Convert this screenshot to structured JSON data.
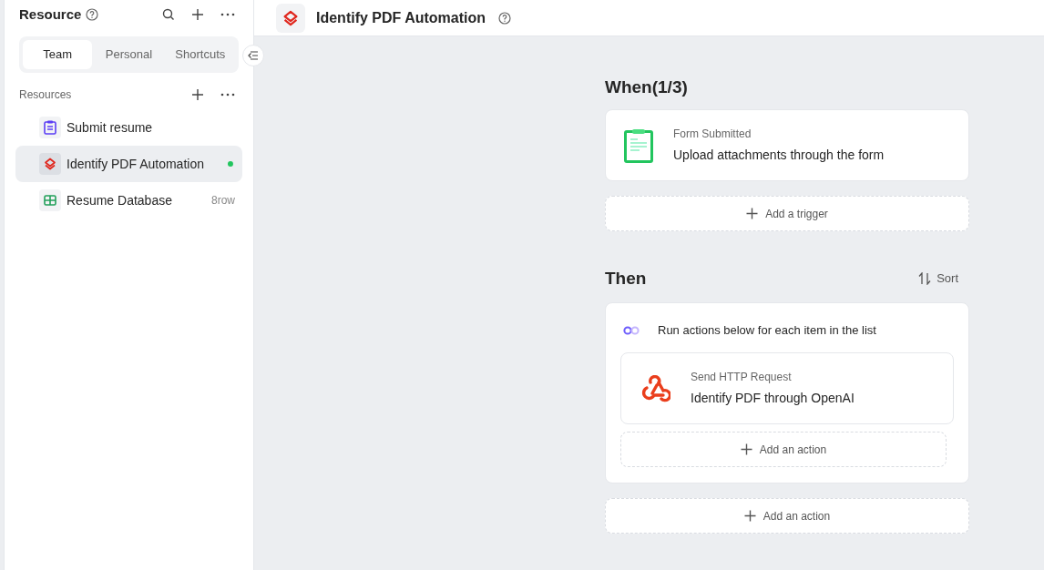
{
  "sidebar": {
    "title": "Resource",
    "tabs": [
      {
        "label": "Team",
        "selected": true
      },
      {
        "label": "Personal",
        "selected": false
      },
      {
        "label": "Shortcuts",
        "selected": false
      }
    ],
    "section_title": "Resources",
    "items": [
      {
        "kind": "form",
        "label": "Submit resume",
        "selected": false
      },
      {
        "kind": "automation",
        "label": "Identify PDF Automation",
        "selected": true,
        "color": "#22c55e"
      },
      {
        "kind": "database",
        "label": "Resume Database",
        "selected": false,
        "meta": "8row"
      }
    ]
  },
  "header": {
    "title": "Identify PDF Automation"
  },
  "when": {
    "title": "When(1/3)",
    "trigger": {
      "type": "Form Submitted",
      "description": "Upload attachments through the form"
    },
    "add_button": "Add a trigger"
  },
  "then": {
    "title": "Then",
    "sort_button": "Sort",
    "loop_label": "Run actions below for each item in the list",
    "action": {
      "type": "Send HTTP Request",
      "description": "Identify PDF through OpenAI"
    },
    "inner_add_button": "Add an action",
    "add_button": "Add an action"
  }
}
